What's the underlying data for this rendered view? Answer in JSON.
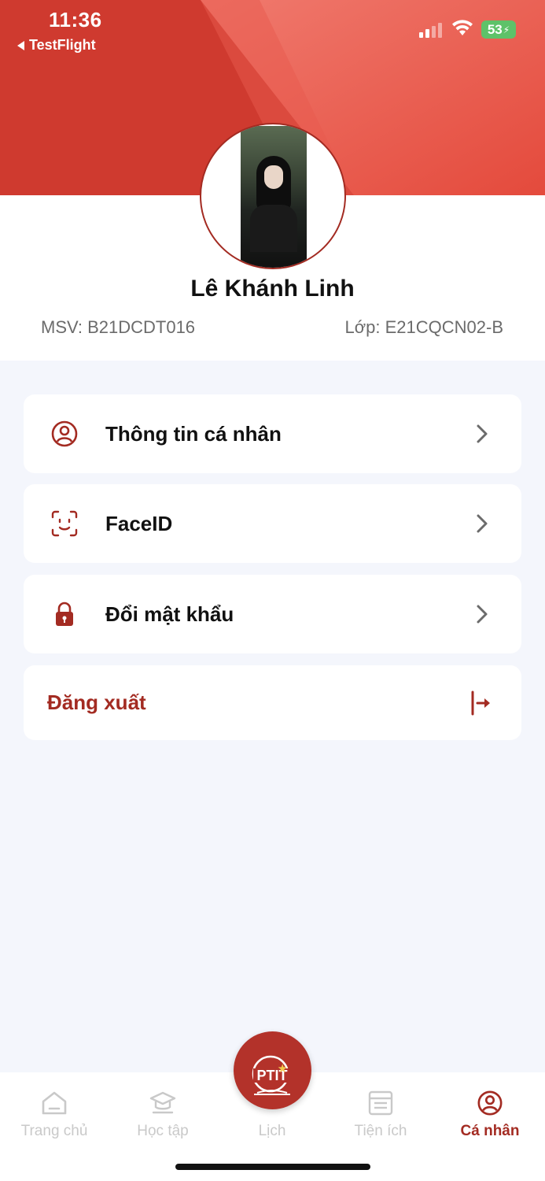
{
  "status_bar": {
    "time": "11:36",
    "back_label": "TestFlight",
    "battery": "53"
  },
  "profile": {
    "name": "Lê Khánh Linh",
    "msv": "MSV: B21DCDT016",
    "lop": "Lớp: E21CQCN02-B"
  },
  "menu": {
    "personal_info": "Thông tin cá nhân",
    "face_id": "FaceID",
    "change_password": "Đổi mật khẩu",
    "logout": "Đăng xuất"
  },
  "tabs": {
    "home": "Trang chủ",
    "study": "Học tập",
    "schedule": "Lịch",
    "utilities": "Tiện ích",
    "profile": "Cá nhân"
  },
  "fab_logo_text": "PTIT",
  "colors": {
    "brand": "#a32b22",
    "header": "#d0382e",
    "background": "#f4f6fc",
    "inactive": "#c9c9c9"
  }
}
